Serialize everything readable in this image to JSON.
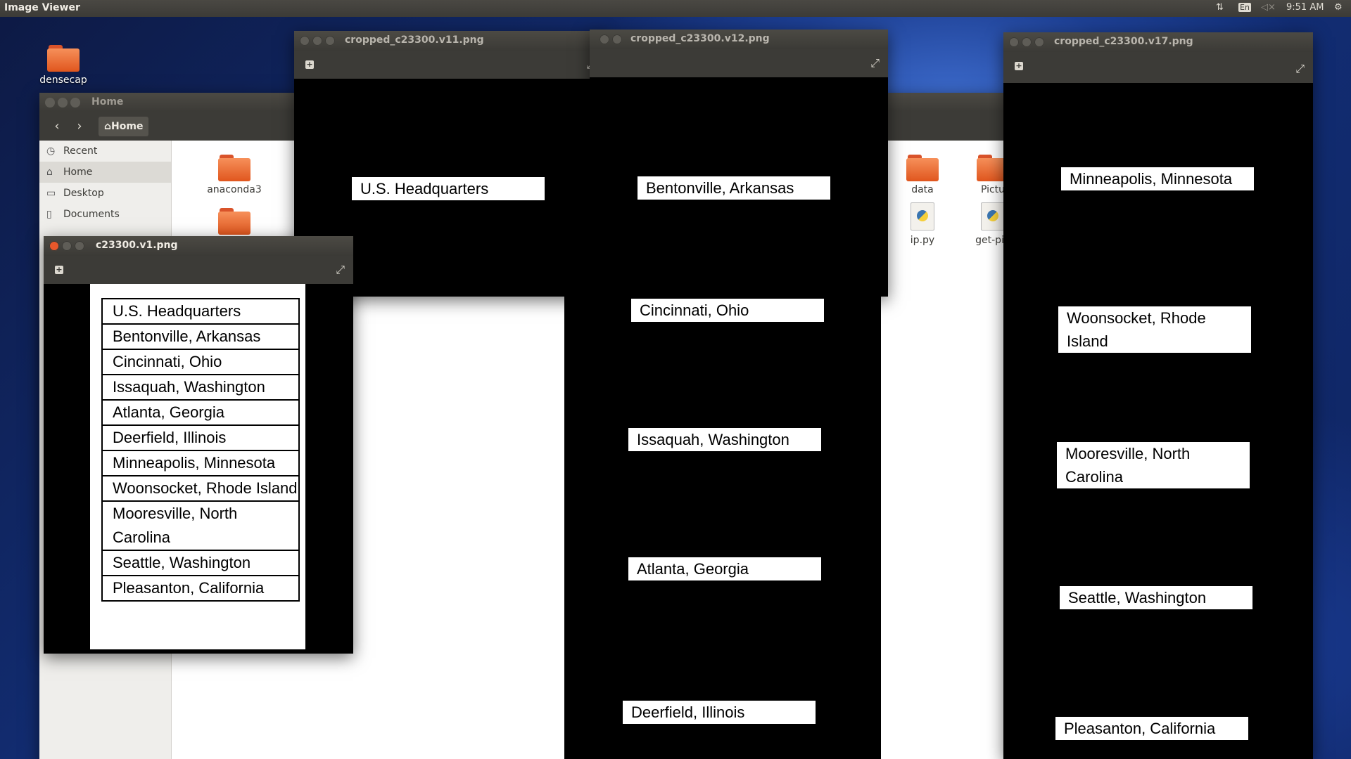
{
  "topbar": {
    "app_title": "Image Viewer",
    "keyboard": "En",
    "time": "9:51 AM",
    "icons": [
      "network-arrows-icon",
      "keyboard-layout-icon",
      "volume-muted-icon",
      "gear-icon"
    ]
  },
  "desktop": {
    "folder_label": "densecap"
  },
  "nautilus": {
    "title": "Home",
    "breadcrumb": "Home",
    "sidebar": [
      {
        "label": "Recent",
        "icon": "clock-icon"
      },
      {
        "label": "Home",
        "icon": "home-icon"
      },
      {
        "label": "Desktop",
        "icon": "folder-icon"
      },
      {
        "label": "Documents",
        "icon": "document-icon"
      }
    ],
    "files": [
      {
        "label": "anaconda3",
        "icon": "folder-icon"
      },
      {
        "label": "data",
        "icon": "folder-icon"
      },
      {
        "label": "Pictu",
        "icon": "folder-icon"
      },
      {
        "label": "ip.py",
        "icon": "python-file-icon"
      },
      {
        "label": "get-pip",
        "icon": "python-file-icon"
      }
    ]
  },
  "viewers": [
    {
      "title": "cropped_c23300.v11.png",
      "labels": [
        "U.S. Headquarters"
      ]
    },
    {
      "title": "cropped_c23300.v12.png",
      "labels": [
        "Bentonville, Arkansas",
        "Cincinnati, Ohio",
        "Issaquah, Washington",
        "Atlanta, Georgia",
        "Deerfield, Illinois"
      ]
    },
    {
      "title": "cropped_c23300.v17.png",
      "labels": [
        "Minneapolis, Minnesota",
        "Woonsocket, Rhode Island",
        "Mooresville, North Carolina",
        "Seattle, Washington",
        "Pleasanton, California"
      ]
    },
    {
      "title": "c23300.v1.png",
      "rows": [
        "U.S. Headquarters",
        "Bentonville, Arkansas",
        "Cincinnati, Ohio",
        "Issaquah, Washington",
        "Atlanta, Georgia",
        "Deerfield, Illinois",
        "Minneapolis, Minnesota",
        "Woonsocket, Rhode Island",
        "Mooresville, North Carolina",
        "Seattle, Washington",
        "Pleasanton, California"
      ]
    }
  ]
}
